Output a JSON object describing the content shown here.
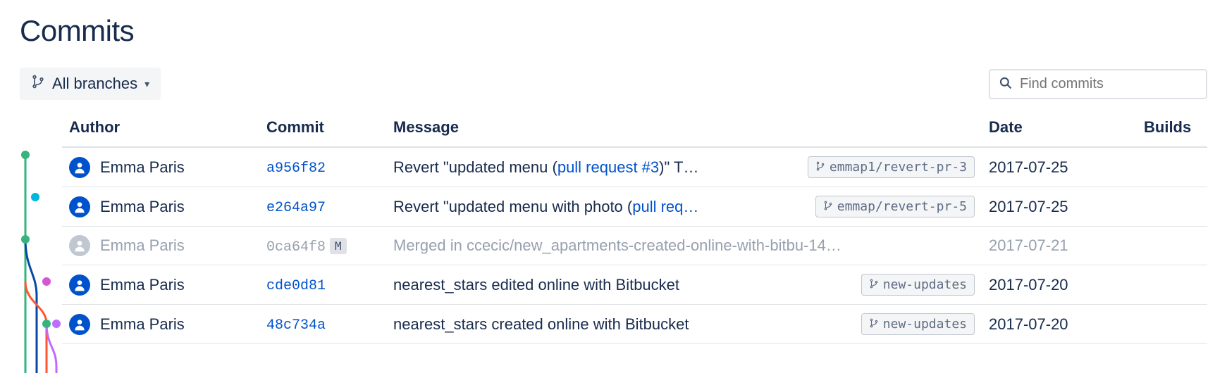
{
  "title": "Commits",
  "toolbar": {
    "branch_filter_label": "All branches",
    "search_placeholder": "Find commits"
  },
  "columns": {
    "author": "Author",
    "commit": "Commit",
    "message": "Message",
    "date": "Date",
    "builds": "Builds"
  },
  "commits": [
    {
      "author": "Emma Paris",
      "hash": "a956f82",
      "message_pre": "Revert \"updated menu (",
      "message_link": "pull request #3",
      "message_post": ")\" T…",
      "branch_tag": "emmap1/revert-pr-3",
      "date": "2017-07-25",
      "merge": false,
      "muted": false
    },
    {
      "author": "Emma Paris",
      "hash": "e264a97",
      "message_pre": "Revert \"updated menu with photo (",
      "message_link": "pull req…",
      "message_post": "",
      "branch_tag": "emmap/revert-pr-5",
      "date": "2017-07-25",
      "merge": false,
      "muted": false
    },
    {
      "author": "Emma Paris",
      "hash": "0ca64f8",
      "message_pre": "Merged in ccecic/new_apartments-created-online-with-bitbu-14…",
      "message_link": "",
      "message_post": "",
      "branch_tag": "",
      "date": "2017-07-21",
      "merge": true,
      "muted": true
    },
    {
      "author": "Emma Paris",
      "hash": "cde0d81",
      "message_pre": "nearest_stars edited online with Bitbucket",
      "message_link": "",
      "message_post": "",
      "branch_tag": "new-updates",
      "date": "2017-07-20",
      "merge": false,
      "muted": false
    },
    {
      "author": "Emma Paris",
      "hash": "48c734a",
      "message_pre": "nearest_stars created online with Bitbucket",
      "message_link": "",
      "message_post": "",
      "branch_tag": "new-updates",
      "date": "2017-07-20",
      "merge": false,
      "muted": false
    }
  ],
  "badges": {
    "merge": "M"
  }
}
